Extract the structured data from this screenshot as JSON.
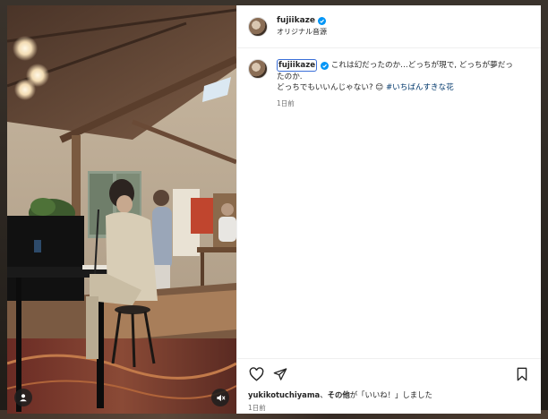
{
  "post": {
    "username": "fujiikaze",
    "audio_label": "オリジナル音源",
    "caption": {
      "line1": "これは幻だったのか…どっちが現で, どっちが夢だったのか.",
      "line2": "どっちでもいいんじゃない? 😊 ",
      "hashtag": "#いちばんすきな花",
      "time": "1日前"
    },
    "likes": {
      "user": "yukikotuchiyama",
      "sep": "、",
      "others": "その他",
      "suffix": "が「いいね！」しました"
    },
    "time": "1日前"
  },
  "icons": {
    "verified": "verified-badge-icon",
    "like": "heart-icon",
    "share": "share-icon",
    "save": "bookmark-icon",
    "user_tag": "user-tag-icon",
    "mute": "mute-icon"
  },
  "colors": {
    "verified_blue": "#0095f6",
    "hashtag": "#00376b",
    "muted_text": "#737373",
    "highlight_border": "#3a6fd8"
  }
}
